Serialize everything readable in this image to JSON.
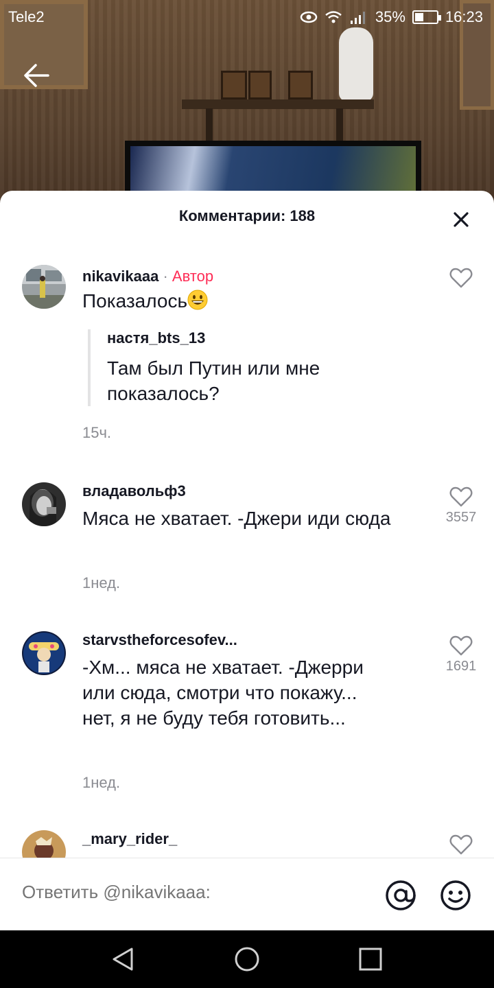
{
  "status_bar": {
    "carrier": "Tele2",
    "battery": "35%",
    "battery_level": 0.35,
    "time": "16:23"
  },
  "sheet": {
    "title": "Комментарии: 188"
  },
  "comments": [
    {
      "username": "nikavikaaa",
      "separator": "·",
      "badge": "Автор",
      "text": "Показалось",
      "emoji": "grinning-face",
      "quote": {
        "username": "настя_bts_13",
        "text": "Там был Путин или мне показалось?"
      },
      "time": "15ч.",
      "likes": ""
    },
    {
      "username": "владавольф3",
      "text": "Мяса не хватает. -Джери иди сюда",
      "time": "1нед.",
      "likes": "3557"
    },
    {
      "username": "starvstheforcesofev...",
      "text": "-Хм... мяса не хватает. -Джерри или сюда, смотри что покажу... нет, я не буду тебя готовить...",
      "time": "1нед.",
      "likes": "1691"
    },
    {
      "username": "_mary_rider_",
      "text": "",
      "time": "",
      "likes": ""
    }
  ],
  "input": {
    "placeholder": "Ответить @nikavikaaa:"
  },
  "icons": {
    "back": "arrow-left-icon",
    "close": "close-icon",
    "like": "heart-outline-icon",
    "mention": "at-sign-icon",
    "emoji": "smiley-icon",
    "nav_back": "triangle-back-icon",
    "nav_home": "circle-home-icon",
    "nav_recent": "square-recent-icon"
  },
  "colors": {
    "author_badge": "#fe2c55",
    "text_primary": "#161823",
    "text_secondary": "#8a8b91"
  }
}
